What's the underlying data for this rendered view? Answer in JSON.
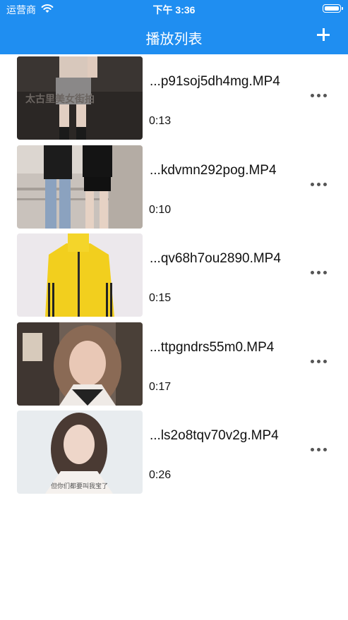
{
  "status_bar": {
    "carrier": "运营商",
    "time": "下午 3:36"
  },
  "nav": {
    "title": "播放列表"
  },
  "colors": {
    "nav_bar": "#1f8ef1",
    "text": "#111111",
    "more_dots": "#555555"
  },
  "playlist": [
    {
      "name": "...p91soj5dh4mg.MP4",
      "duration": "0:13",
      "thumb_caption": "太古里美女街拍"
    },
    {
      "name": "...kdvmn292pog.MP4",
      "duration": "0:10"
    },
    {
      "name": "...qv68h7ou2890.MP4",
      "duration": "0:15"
    },
    {
      "name": "...ttpgndrs55m0.MP4",
      "duration": "0:17"
    },
    {
      "name": "...ls2o8tqv70v2g.MP4",
      "duration": "0:26",
      "thumb_caption": "但你们都要叫我宝了"
    }
  ]
}
